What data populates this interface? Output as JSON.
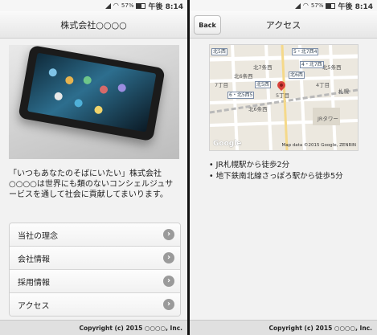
{
  "status": {
    "battery": "57%",
    "time": "午後 8:14"
  },
  "left": {
    "title": "株式会社○○○○",
    "description": "「いつもあなたのそばにいたい」株式会社○○○○は世界にも類のないコンシェルジュサービスを通して社会に貢献してまいります。",
    "menu": [
      {
        "label": "当社の理念"
      },
      {
        "label": "会社情報"
      },
      {
        "label": "採用情報"
      },
      {
        "label": "アクセス"
      }
    ],
    "footer": "Copyright (c) 2015 ○○○○, Inc."
  },
  "right": {
    "back_label": "Back",
    "title": "アクセス",
    "map": {
      "labels": {
        "l1": "北7条西",
        "l2": "北6条西",
        "l3": "5・北7西4",
        "l4": "4・北7西",
        "l5": "北6西",
        "l6": "北5条西",
        "l7": "北5西",
        "l8": "6・北5西5",
        "l9": "北6条西",
        "l10": "JRタワー",
        "l11": "札幌",
        "l12": "4丁目",
        "l13": "5丁目",
        "l14": "7丁目",
        "l15": "北5西"
      },
      "google": "Google",
      "attribution": "Map data ©2015 Google, ZENRIN"
    },
    "access": [
      "JR札幌駅から徒歩2分",
      "地下鉄南北線さっぽろ駅から徒歩5分"
    ],
    "footer": "Copyright (c) 2015 ○○○○, Inc."
  }
}
